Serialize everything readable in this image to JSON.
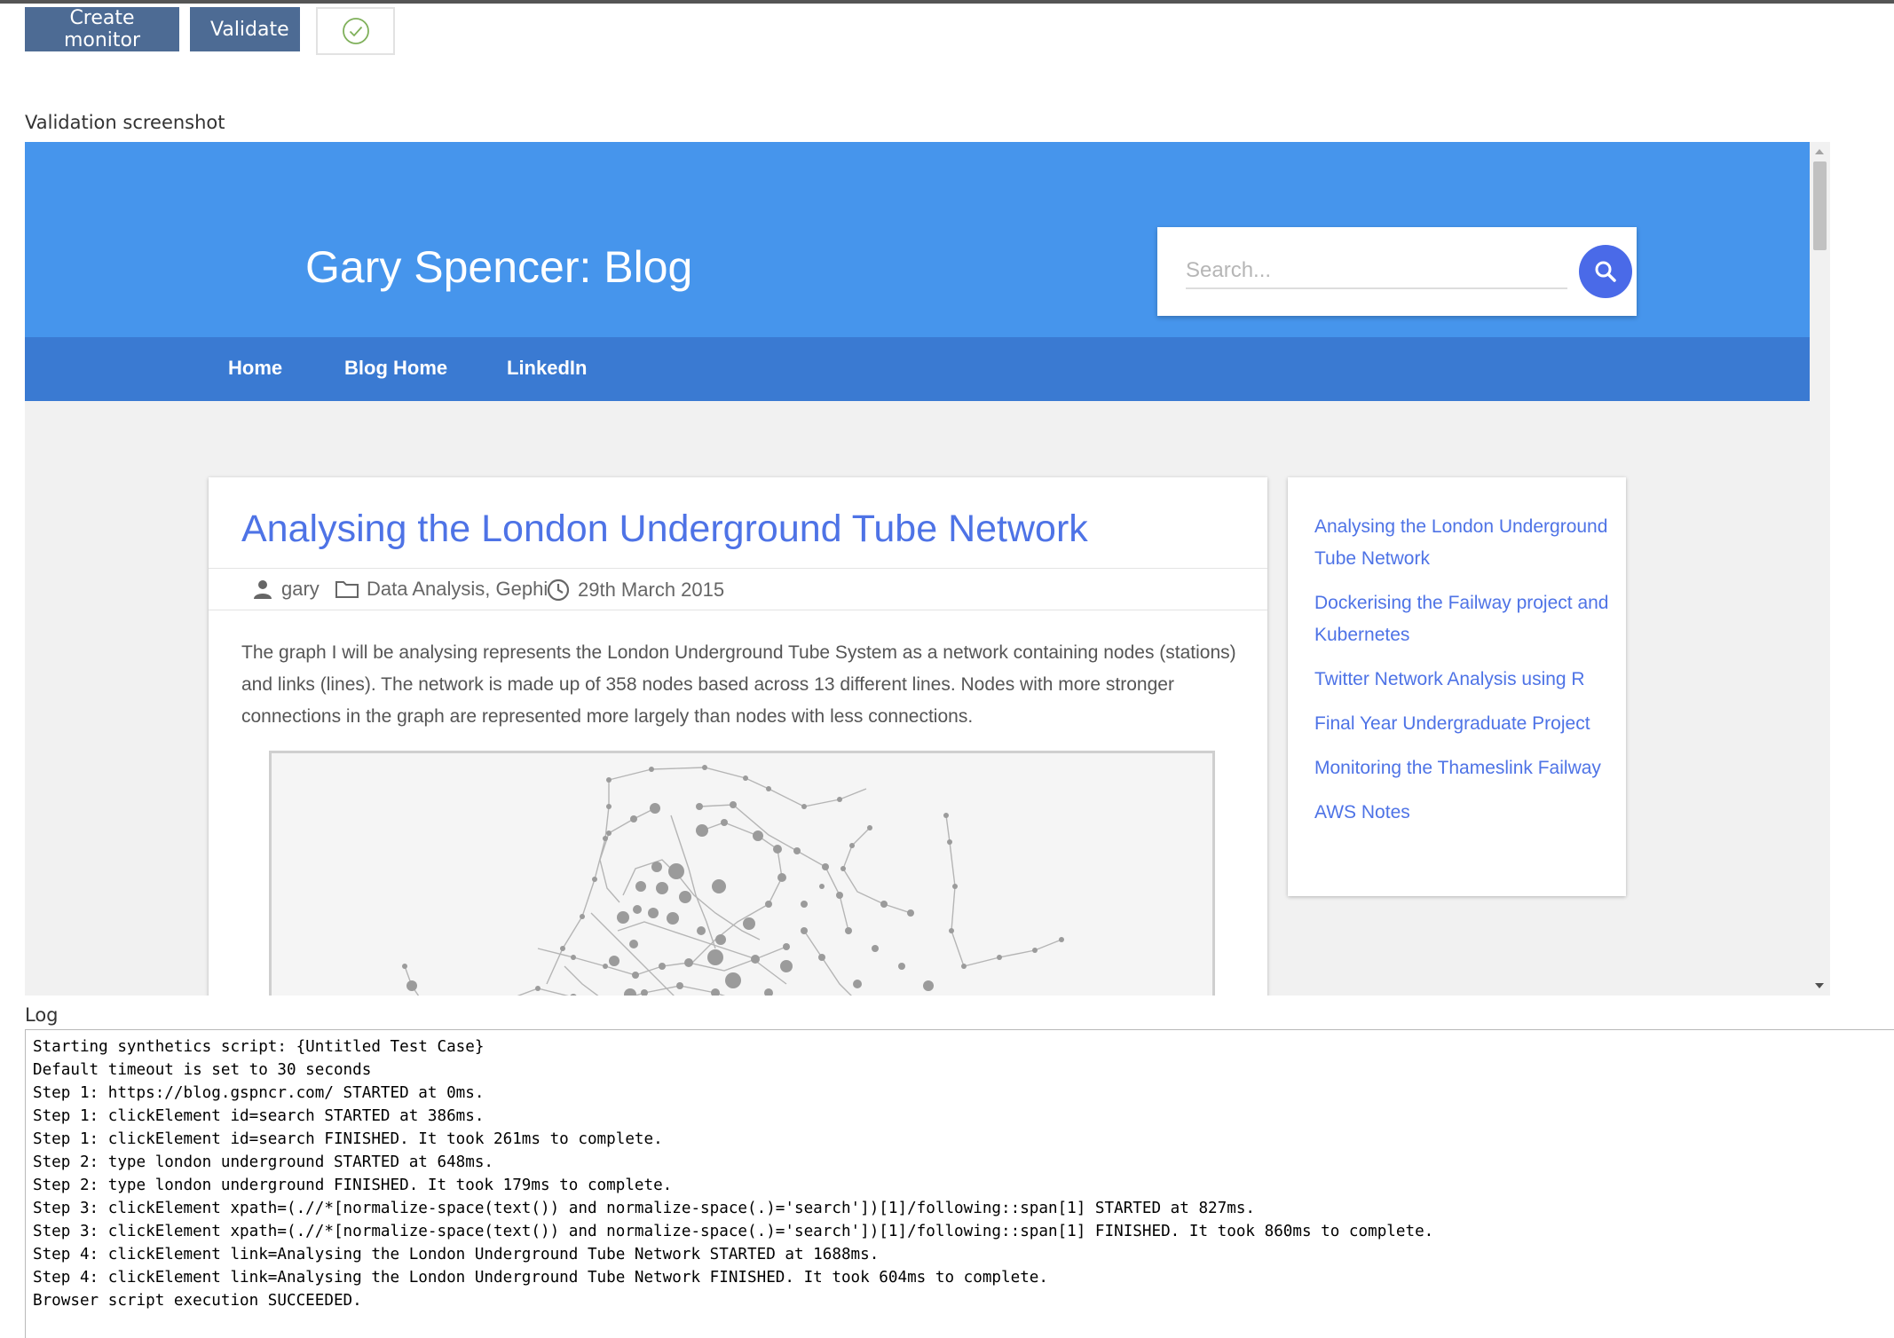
{
  "toolbar": {
    "create_label": "Create monitor",
    "validate_label": "Validate",
    "status_icon": "check-circle-icon",
    "status_color": "#7fb05a"
  },
  "validation_label": "Validation screenshot",
  "screenshot": {
    "blog_title": "Gary Spencer: Blog",
    "search_placeholder": "Search...",
    "header_color": "#4695ec",
    "nav_color": "#3a7ad2",
    "link_color": "#4e73e6",
    "nav": [
      "Home",
      "Blog Home",
      "LinkedIn"
    ],
    "post": {
      "title": "Analysing the London Underground Tube Network",
      "author": "gary",
      "categories": "Data Analysis, Gephi",
      "date": "29th March 2015",
      "body_lines": [
        "The graph I will be analysing represents the London Underground Tube System as a network containing nodes (stations)",
        "and links (lines). The network is made up of 358 nodes based across 13 different lines. Nodes with more stronger",
        "connections in the graph are represented more largely than nodes with less connections."
      ]
    },
    "sidebar_links": [
      "Analysing the London Underground Tube Network",
      "Dockerising the Failway project and Kubernetes",
      "Twitter Network Analysis using R",
      "Final Year Undergraduate Project",
      "Monitoring the Thameslink Failway",
      "AWS Notes"
    ]
  },
  "log_label": "Log",
  "log_lines": [
    "Starting synthetics script: {Untitled Test Case}",
    "Default timeout is set to 30 seconds",
    "Step 1: https://blog.gspncr.com/ STARTED at 0ms.",
    "Step 1: clickElement id=search STARTED at 386ms.",
    "Step 1: clickElement id=search FINISHED. It took 261ms to complete.",
    "Step 2: type london underground STARTED at 648ms.",
    "Step 2: type london underground FINISHED. It took 179ms to complete.",
    "Step 3: clickElement xpath=(.//*[normalize-space(text()) and normalize-space(.)='search'])[1]/following::span[1] STARTED at 827ms.",
    "Step 3: clickElement xpath=(.//*[normalize-space(text()) and normalize-space(.)='search'])[1]/following::span[1] FINISHED. It took 860ms to complete.",
    "Step 4: clickElement link=Analysing the London Underground Tube Network STARTED at 1688ms.",
    "Step 4: clickElement link=Analysing the London Underground Tube Network FINISHED. It took 604ms to complete.",
    "Browser script execution SUCCEEDED."
  ]
}
